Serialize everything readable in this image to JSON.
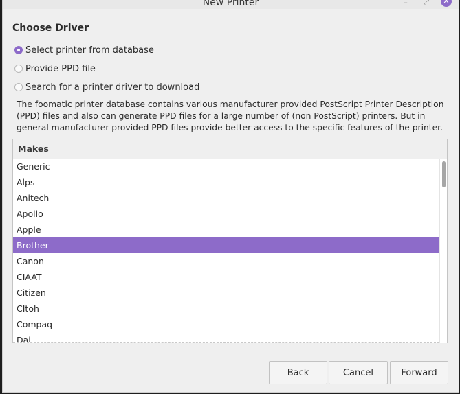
{
  "window": {
    "title": "New Printer",
    "controls": {
      "minimize": "–",
      "maximize": "⤢",
      "close": "✕"
    }
  },
  "heading": "Choose Driver",
  "options": [
    {
      "label": "Select printer from database",
      "checked": true
    },
    {
      "label": "Provide PPD file",
      "checked": false
    },
    {
      "label": "Search for a printer driver to download",
      "checked": false
    }
  ],
  "description": "The foomatic printer database contains various manufacturer provided PostScript Printer Description (PPD) files and also can generate PPD files for a large number of (non PostScript) printers. But in general manufacturer provided PPD files provide better access to the specific features of the printer.",
  "makes": {
    "header": "Makes",
    "items": [
      "Generic",
      "Alps",
      "Anitech",
      "Apollo",
      "Apple",
      "Brother",
      "Canon",
      "CIAAT",
      "Citizen",
      "CItoh",
      "Compaq",
      "Dai"
    ],
    "selected": "Brother"
  },
  "buttons": {
    "back": "Back",
    "cancel": "Cancel",
    "forward": "Forward"
  },
  "colors": {
    "accent": "#8d6bc9"
  }
}
